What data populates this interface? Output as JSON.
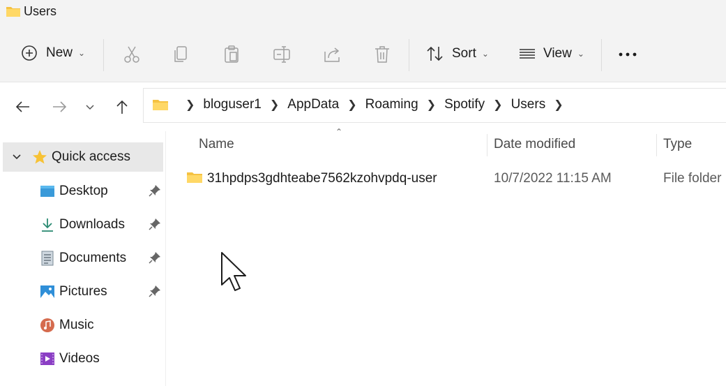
{
  "window": {
    "title": "Users"
  },
  "commands": {
    "new_label": "New",
    "sort_label": "Sort",
    "view_label": "View",
    "icons": [
      "cut-icon",
      "copy-icon",
      "paste-icon",
      "rename-icon",
      "share-icon",
      "delete-icon"
    ]
  },
  "address": {
    "segments": [
      "bloguser1",
      "AppData",
      "Roaming",
      "Spotify",
      "Users"
    ]
  },
  "nav": {
    "quick_access": "Quick access",
    "items": [
      {
        "label": "Desktop",
        "icon": "desktop-icon",
        "pinned": true
      },
      {
        "label": "Downloads",
        "icon": "downloads-icon",
        "pinned": true
      },
      {
        "label": "Documents",
        "icon": "documents-icon",
        "pinned": true
      },
      {
        "label": "Pictures",
        "icon": "pictures-icon",
        "pinned": true
      },
      {
        "label": "Music",
        "icon": "music-icon",
        "pinned": false
      },
      {
        "label": "Videos",
        "icon": "videos-icon",
        "pinned": false
      }
    ]
  },
  "columns": {
    "name": "Name",
    "date": "Date modified",
    "type": "Type"
  },
  "files": [
    {
      "name": "31hpdps3gdhteabe7562kzohvpdq-user",
      "date": "10/7/2022 11:15 AM",
      "type": "File folder"
    }
  ],
  "colors": {
    "folder": "#f5c242",
    "accent": "#0067c0",
    "selection": "#e8e8e8"
  }
}
